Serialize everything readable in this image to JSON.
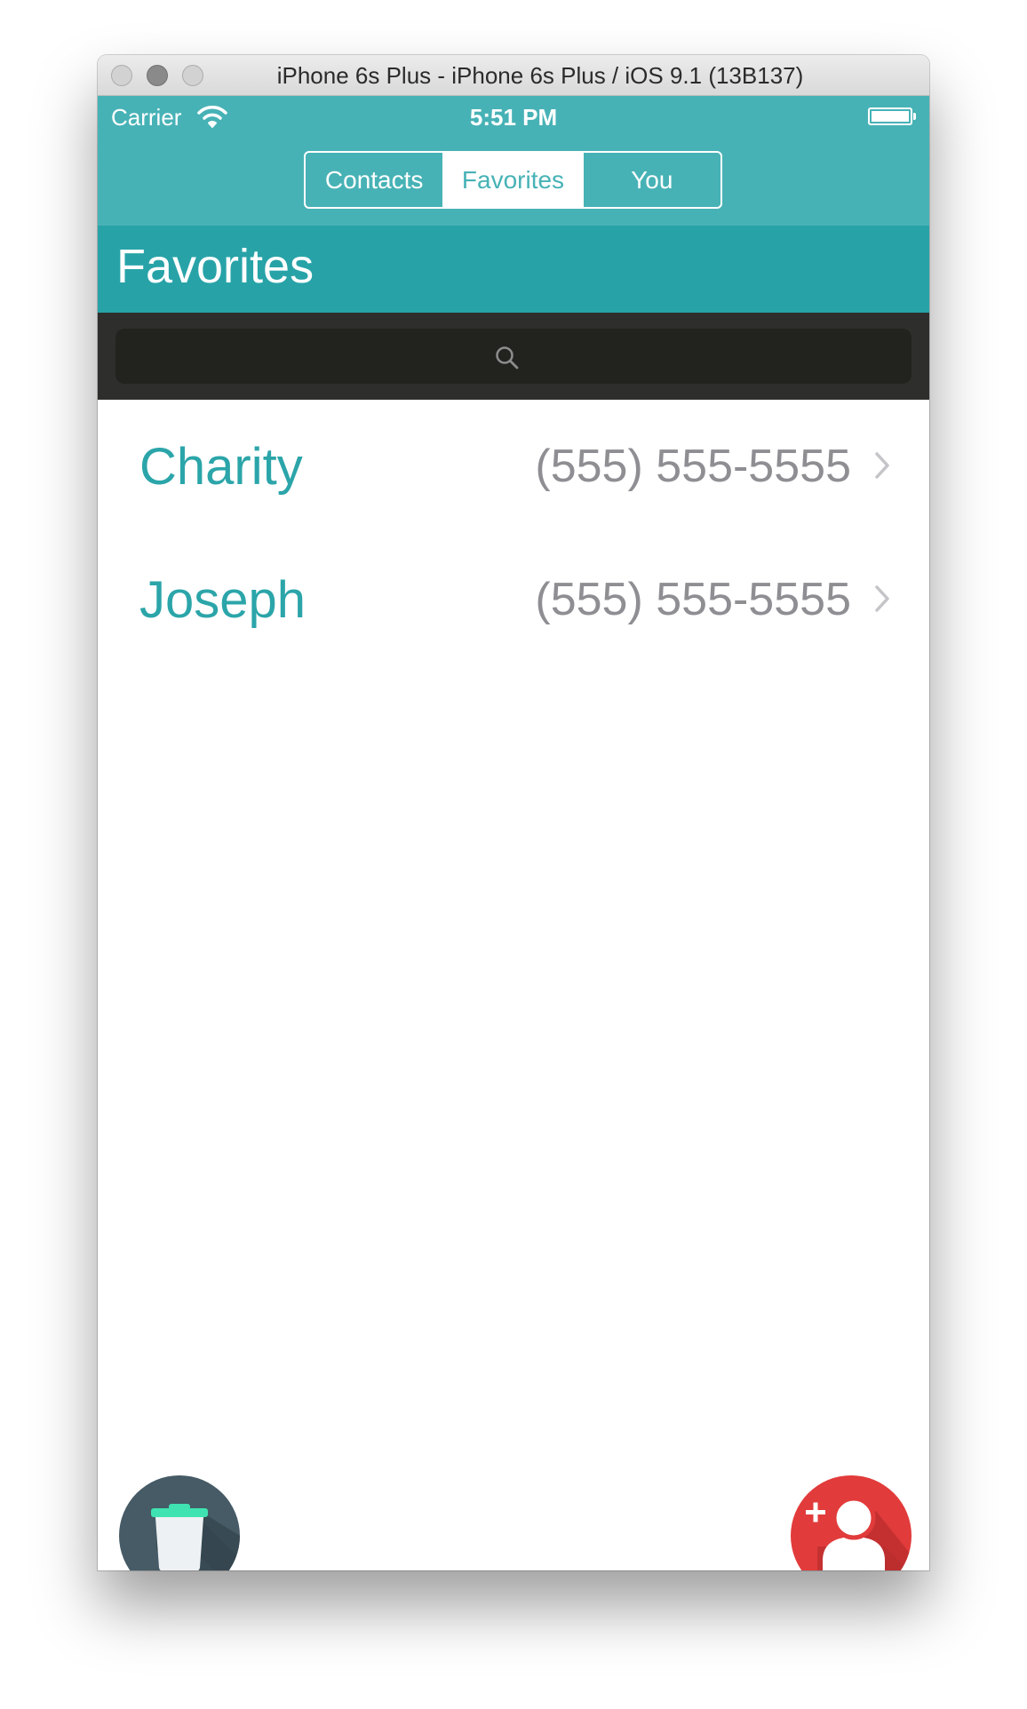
{
  "window": {
    "title": "iPhone 6s Plus - iPhone 6s Plus / iOS 9.1 (13B137)"
  },
  "status_bar": {
    "carrier": "Carrier",
    "time": "5:51 PM",
    "battery_level": 1.0
  },
  "tabs": [
    {
      "label": "Contacts",
      "selected": false
    },
    {
      "label": "Favorites",
      "selected": true
    },
    {
      "label": "You",
      "selected": false
    }
  ],
  "header": {
    "title": "Favorites"
  },
  "search": {
    "placeholder": "",
    "value": ""
  },
  "contacts": [
    {
      "name": "Charity",
      "phone": "(555) 555-5555"
    },
    {
      "name": "Joseph",
      "phone": "(555) 555-5555"
    }
  ],
  "icons": {
    "trash": "trash-icon",
    "add_contact": "add-contact-icon"
  },
  "colors": {
    "nav_teal": "#47b2b6",
    "header_teal": "#27a3a8",
    "contact_name": "#2ba5a9",
    "phone_gray": "#8e8e93",
    "trash_button": "#465b66",
    "add_button": "#e23b3b",
    "trash_lid": "#3fe3b1"
  }
}
